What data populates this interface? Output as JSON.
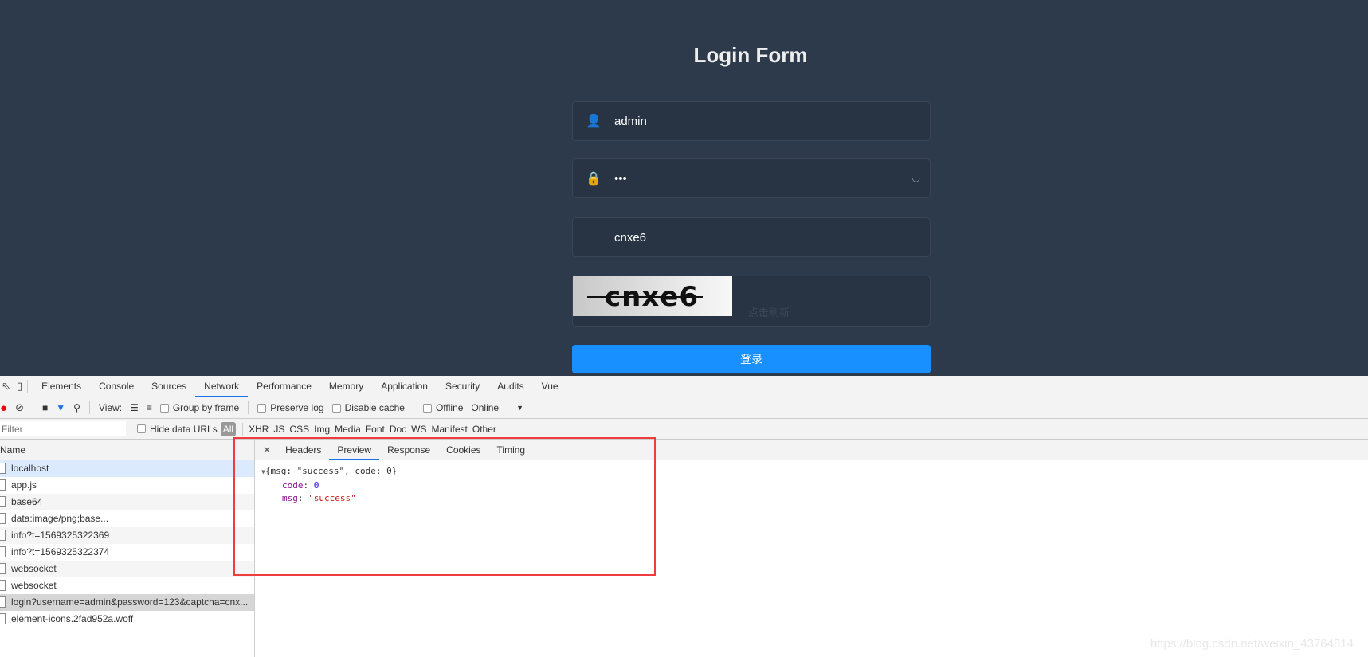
{
  "login": {
    "title": "Login Form",
    "username": "admin",
    "password_masked": "•••",
    "captcha_value": "cnxe6",
    "captcha_image_text": "cnxe6",
    "refresh_hint": "点击刷新",
    "submit_label": "登录"
  },
  "devtools": {
    "tabs": [
      "Elements",
      "Console",
      "Sources",
      "Network",
      "Performance",
      "Memory",
      "Application",
      "Security",
      "Audits",
      "Vue"
    ],
    "active_tab": "Network",
    "toolbar": {
      "view_label": "View:",
      "group_by_frame": "Group by frame",
      "preserve_log": "Preserve log",
      "disable_cache": "Disable cache",
      "offline": "Offline",
      "throttle": "Online"
    },
    "filter": {
      "placeholder": "Filter",
      "hide_data_urls": "Hide data URLs",
      "types": [
        "All",
        "XHR",
        "JS",
        "CSS",
        "Img",
        "Media",
        "Font",
        "Doc",
        "WS",
        "Manifest",
        "Other"
      ]
    },
    "name_header": "Name",
    "requests": [
      "localhost",
      "app.js",
      "base64",
      "data:image/png;base...",
      "info?t=1569325322369",
      "info?t=1569325322374",
      "websocket",
      "websocket",
      "login?username=admin&password=123&captcha=cnx...",
      "element-icons.2fad952a.woff"
    ],
    "detail_tabs": [
      "Headers",
      "Preview",
      "Response",
      "Cookies",
      "Timing"
    ],
    "active_detail_tab": "Preview",
    "preview": {
      "summary": "{msg: \"success\", code: 0}",
      "code_key": "code",
      "code_value": "0",
      "msg_key": "msg",
      "msg_value": "\"success\""
    }
  },
  "watermark": "https://blog.csdn.net/weixin_43764814",
  "colors": {
    "background": "#2d3a4b",
    "primary": "#1890ff",
    "highlight": "#f03c3c"
  }
}
